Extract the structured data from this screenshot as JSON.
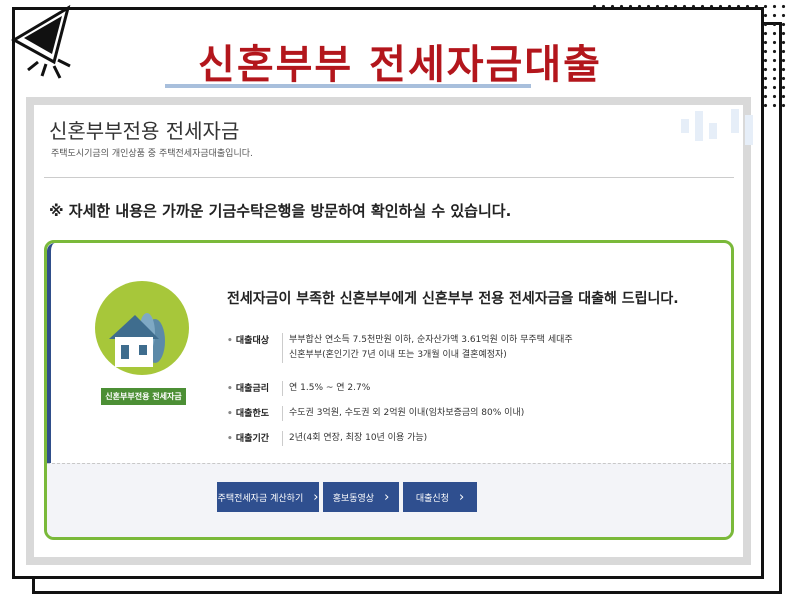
{
  "slide": {
    "title": "신혼부부 전세자금대출"
  },
  "page": {
    "heading": "신혼부부전용 전세자금",
    "subtitle": "주택도시기금의 개인상품 중 주택전세자금대출입니다.",
    "notice": "※ 자세한 내용은 가까운 기금수탁은행을 방문하여 확인하실 수 있습니다."
  },
  "card": {
    "badge_label": "신혼부부전용 전세자금",
    "title": "전세자금이 부족한 신혼부부에게 신혼부부 전용 전세자금을 대출해 드립니다.",
    "rows": [
      {
        "label": "대출대상",
        "lines": [
          "부부합산 연소득 7.5천만원 이하, 순자산가액 3.61억원 이하 무주택 세대주",
          "신혼부부(혼인기간 7년 이내 또는 3개월 이내 결혼예정자)"
        ]
      },
      {
        "label": "대출금리",
        "lines": [
          "연 1.5% ~ 연 2.7%"
        ]
      },
      {
        "label": "대출한도",
        "lines": [
          "수도권 3억원, 수도권 외 2억원 이내(임차보증금의 80% 이내)"
        ]
      },
      {
        "label": "대출기간",
        "lines": [
          "2년(4회 연장, 최장 10년 이용 가능)"
        ]
      }
    ],
    "buttons": [
      {
        "label": "주택전세자금 계산하기",
        "chevron": "›"
      },
      {
        "label": "홍보동영상",
        "chevron": "›"
      },
      {
        "label": "대출신청",
        "chevron": "›"
      }
    ]
  },
  "colors": {
    "title_red": "#b3161c",
    "card_green": "#7ab93a",
    "button_navy": "#2f4f8f"
  }
}
